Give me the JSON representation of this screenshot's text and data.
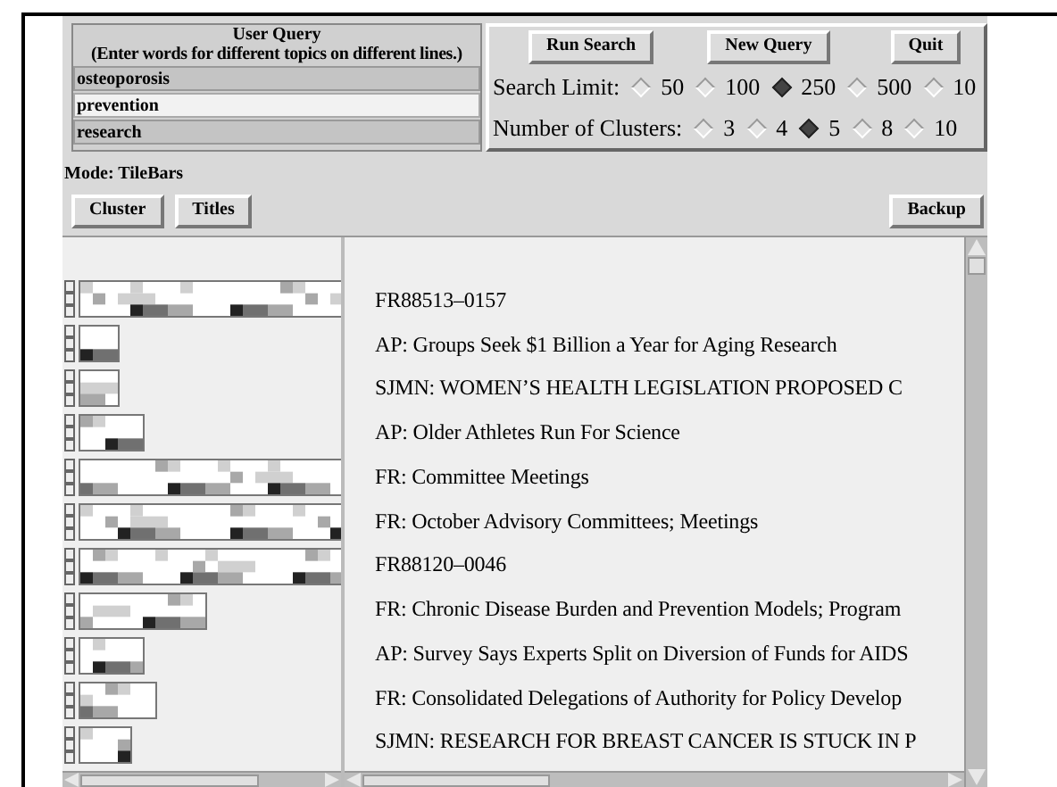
{
  "query": {
    "title": "User Query",
    "subtitle": "(Enter words for different topics on different lines.)",
    "lines": [
      {
        "value": "osteoporosis",
        "focused": false
      },
      {
        "value": "prevention",
        "focused": true
      },
      {
        "value": "research",
        "focused": false
      }
    ]
  },
  "buttons": [
    "Run Search",
    "New Query",
    "Quit"
  ],
  "search_limit": {
    "label": "Search Limit:",
    "options": [
      {
        "label": "50",
        "selected": false
      },
      {
        "label": "100",
        "selected": false
      },
      {
        "label": "250",
        "selected": true
      },
      {
        "label": "500",
        "selected": false
      },
      {
        "label": "10",
        "selected": false
      }
    ]
  },
  "clusters": {
    "label": "Number of Clusters:",
    "options": [
      {
        "label": "3",
        "selected": false
      },
      {
        "label": "4",
        "selected": false
      },
      {
        "label": "5",
        "selected": true
      },
      {
        "label": "8",
        "selected": false
      },
      {
        "label": "10",
        "selected": false
      }
    ]
  },
  "mode": "Mode: TileBars",
  "view_buttons": [
    "Cluster",
    "Titles"
  ],
  "backup_button": "Backup",
  "results": [
    {
      "title": "FR88513–0157"
    },
    {
      "title": "AP: Groups Seek $1 Billion a Year for Aging Research"
    },
    {
      "title": "SJMN: WOMEN’S HEALTH LEGISLATION PROPOSED C"
    },
    {
      "title": "AP: Older Athletes Run For Science"
    },
    {
      "title": "FR: Committee Meetings"
    },
    {
      "title": "FR: October Advisory Committees; Meetings"
    },
    {
      "title": "FR88120–0046"
    },
    {
      "title": "FR: Chronic Disease Burden and Prevention Models; Program"
    },
    {
      "title": "AP: Survey Says Experts Split on Diversion of Funds for AIDS"
    },
    {
      "title": "FR: Consolidated Delegations of Authority for Policy Develop"
    },
    {
      "title": "SJMN: RESEARCH FOR BREAST CANCER IS STUCK IN P"
    }
  ]
}
